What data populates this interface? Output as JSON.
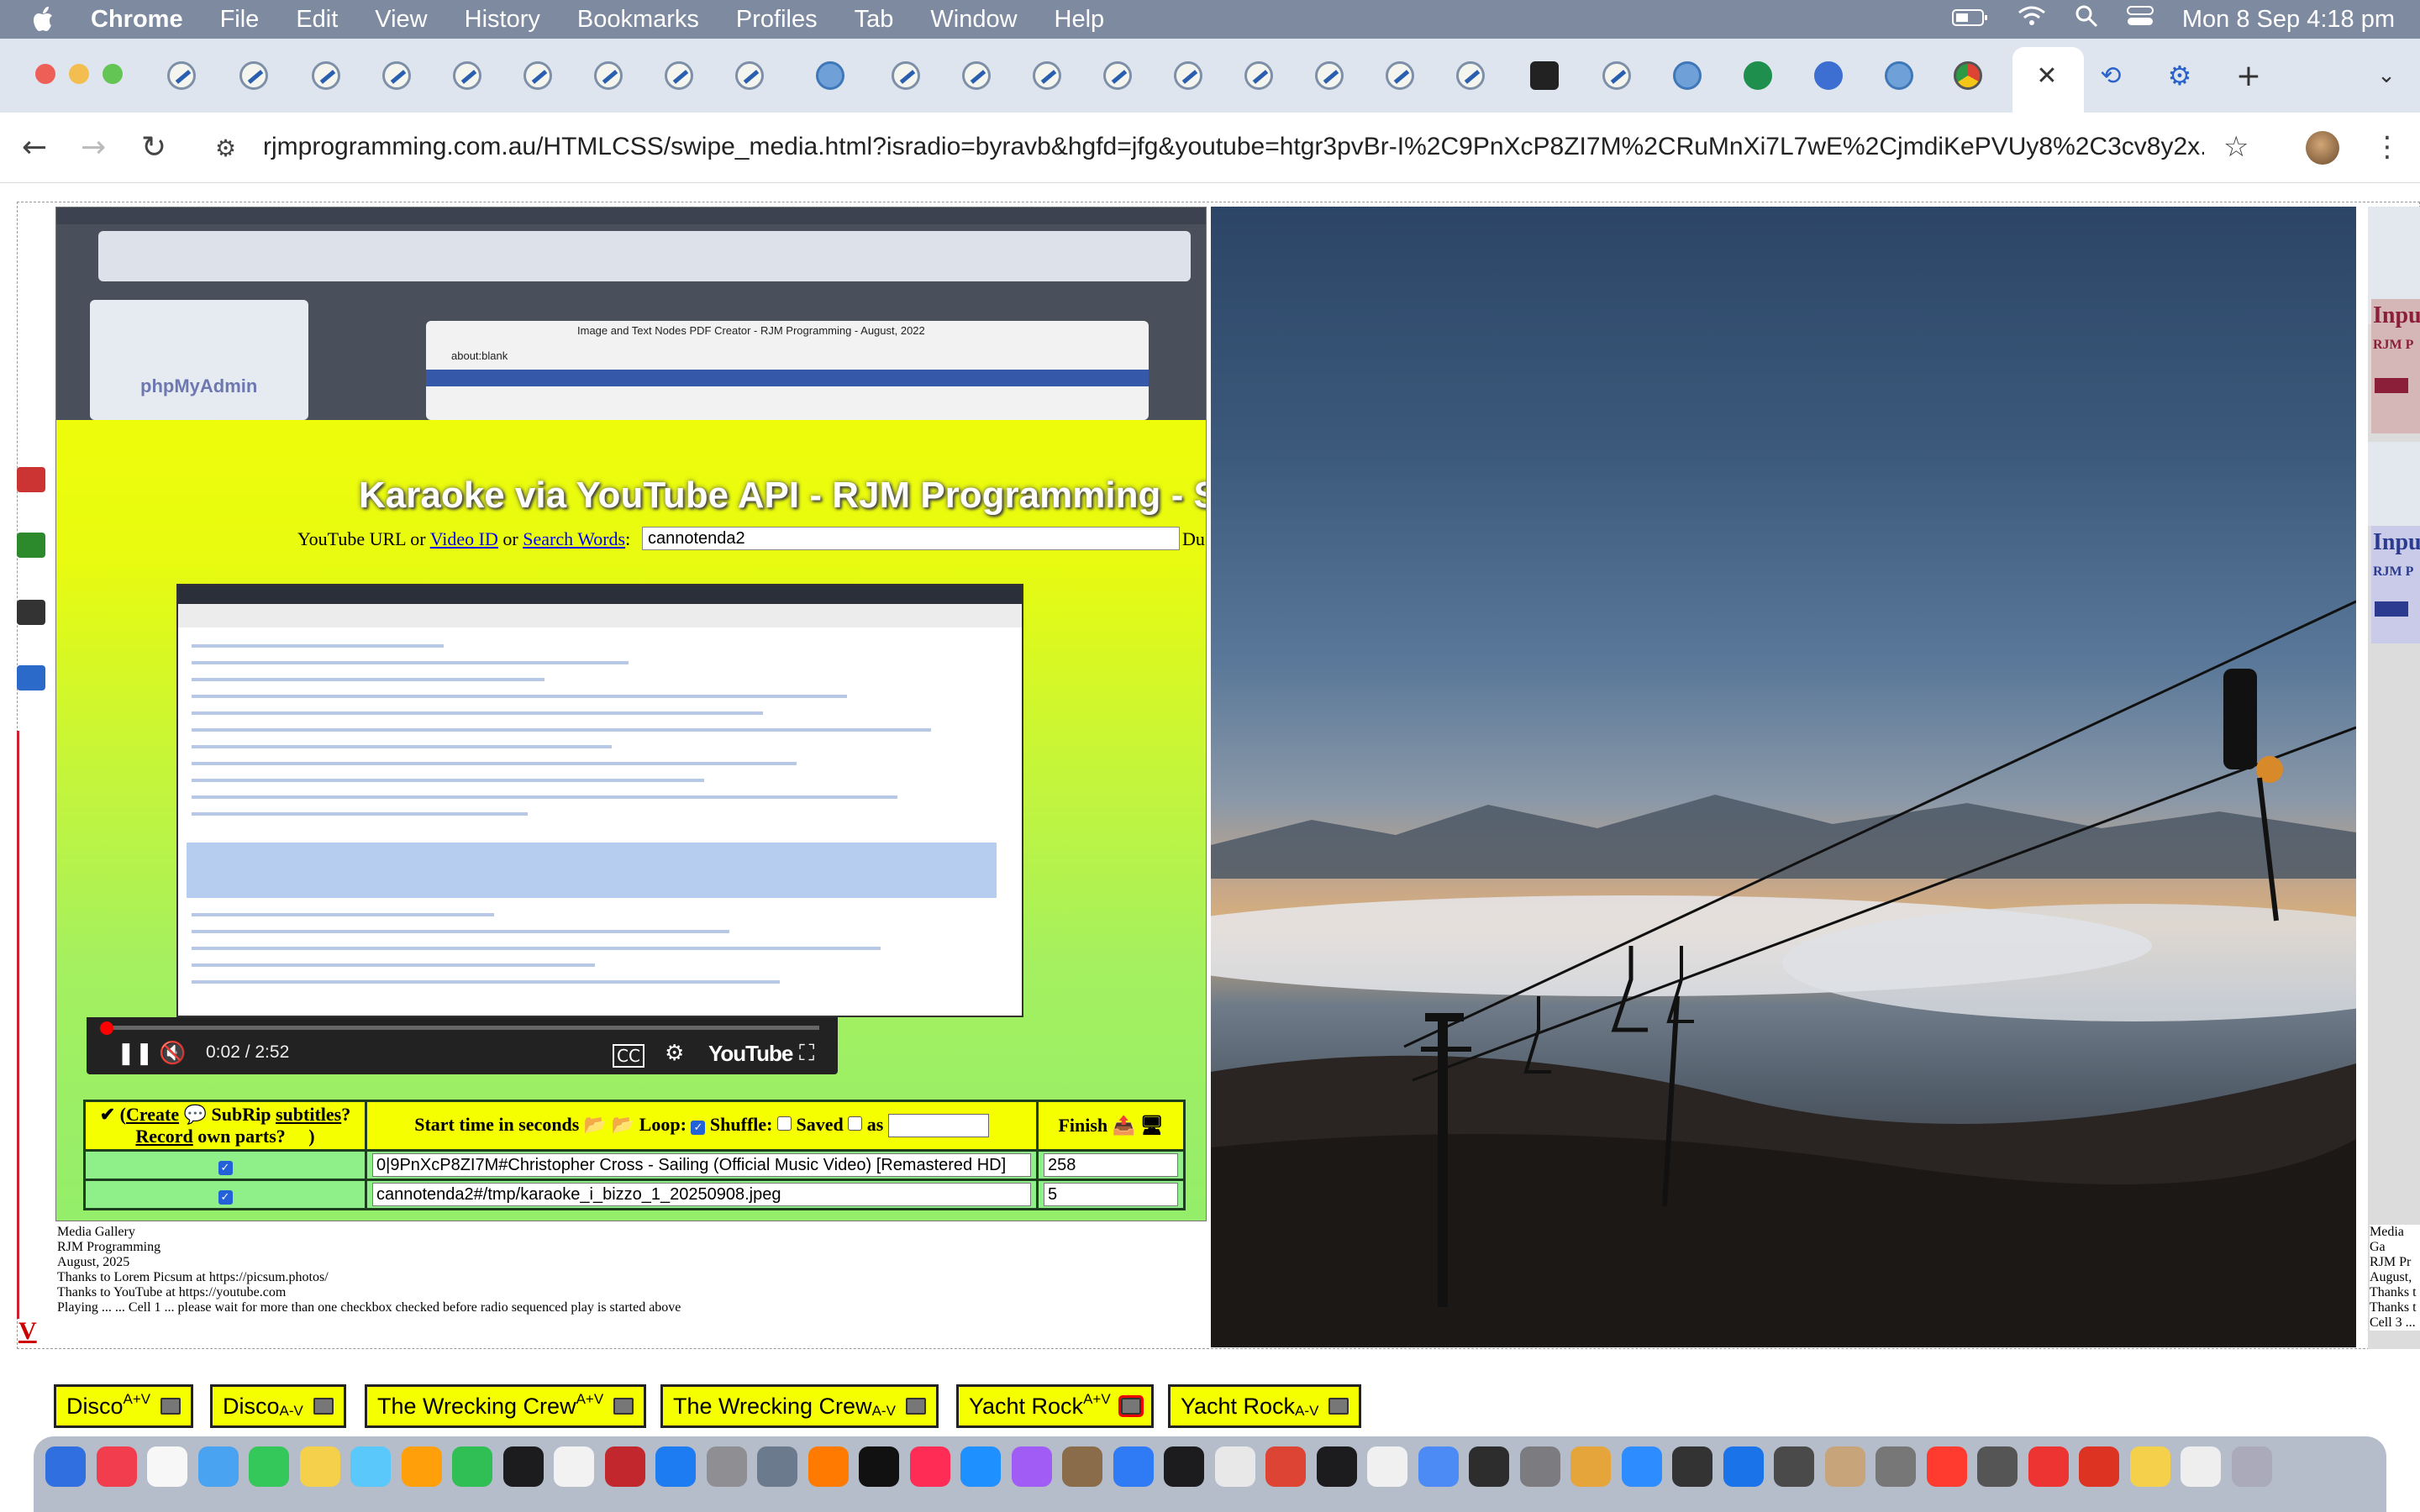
{
  "menubar": {
    "app": "Chrome",
    "items": [
      "File",
      "Edit",
      "View",
      "History",
      "Bookmarks",
      "Profiles",
      "Tab",
      "Window",
      "Help"
    ],
    "clock": "Mon 8 Sep  4:18 pm"
  },
  "browser": {
    "url": "rjmprogramming.com.au/HTMLCSS/swipe_media.html?isradio=byravb&hgfd=jfg&youtube=htgr3pvBr-I%2C9PnXcP8ZI7M%2CRuMnXi7L7wE%2CjmdiKePVUy8%2C3cv8y2x..."
  },
  "karaoke": {
    "heading": "Karaoke via YouTube API - RJM Programming - Se",
    "search_label_prefix": "YouTube URL or",
    "video_id_link": "Video ID",
    "or_word": "or",
    "search_words_link": "Search Words",
    "search_value": "cannotenda2",
    "search_suffix": "Du",
    "player": {
      "time": "0:02 / 2:52",
      "youtube_label": "YouTube",
      "progress_fraction": 0.011
    },
    "table": {
      "header_col1_a": "✔ (",
      "header_create": "Create",
      "header_subrip": "SubRip",
      "header_subtitles": "subtitles",
      "header_q": "?",
      "header_record": "Record",
      "header_own": "own parts?",
      "header_close": ")",
      "header_col2_start": "Start time in seconds",
      "header_loop": "Loop:",
      "header_shuffle": "Shuffle:",
      "header_saved": "Saved",
      "header_as": "as",
      "header_col3": "Finish",
      "rows": [
        {
          "title": "0|9PnXcP8ZI7M#Christopher Cross - Sailing (Official Music Video) [Remastered HD]",
          "finish": "258"
        },
        {
          "title": "cannotenda2#/tmp/karaoke_i_bizzo_1_20250908.jpeg",
          "finish": "5"
        }
      ]
    }
  },
  "notes": {
    "lines": [
      "Media Gallery",
      "RJM Programming",
      "August, 2025",
      "Thanks to Lorem Picsum at https://picsum.photos/",
      "Thanks to YouTube at https://youtube.com",
      "Playing ... ... Cell 1 ... please wait for more than one checkbox checked before radio sequenced play is started above"
    ],
    "right_lines": [
      "Media Ga",
      "RJM Pr",
      "August,",
      "Thanks t",
      "Thanks t",
      "Cell 3 ..."
    ]
  },
  "playlist_buttons": [
    {
      "name": "Disco",
      "tag": "A+V",
      "pos": "sup"
    },
    {
      "name": "Disco",
      "tag": "A-V",
      "pos": "sub"
    },
    {
      "name": "The Wrecking Crew",
      "tag": "A+V",
      "pos": "sup"
    },
    {
      "name": "The Wrecking Crew",
      "tag": "A-V",
      "pos": "sub"
    },
    {
      "name": "Yacht Rock",
      "tag": "A+V",
      "pos": "sup"
    },
    {
      "name": "Yacht Rock",
      "tag": "A-V",
      "pos": "sub"
    }
  ],
  "mini_screenshot": {
    "window_title": "Image and Text Nodes PDF Creator - RJM Programming - August, 2022",
    "about_blank": "about:blank",
    "phpmyadmin": "phpMyAdmin"
  },
  "right_strip": {
    "label1": "Inpu",
    "label2": "RJM P"
  },
  "colors": {
    "menubar": "#7e8aa0",
    "panel_yellow": "#f6ff00",
    "panel_green": "#94ee6a"
  }
}
